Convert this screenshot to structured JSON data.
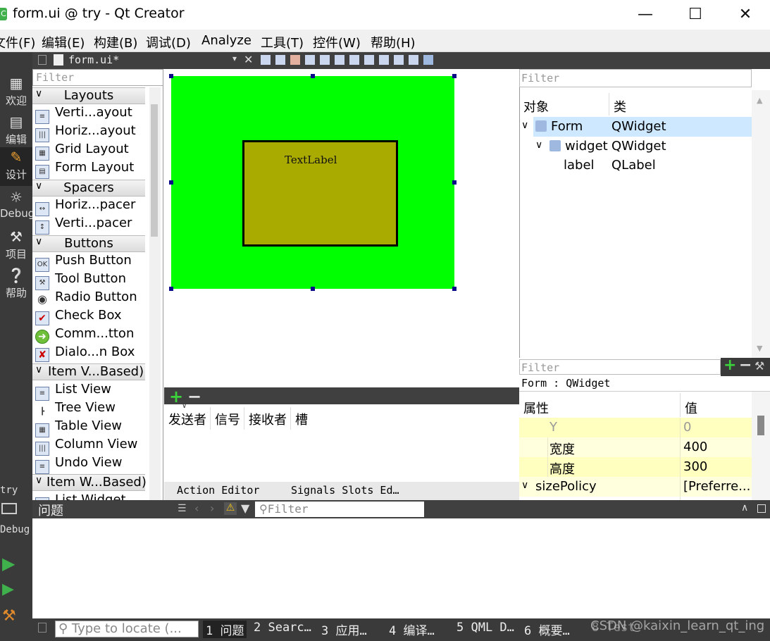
{
  "window": {
    "title": "form.ui @ try - Qt Creator",
    "app_icon": "C"
  },
  "menubar": [
    "文件(F)",
    "编辑(E)",
    "构建(B)",
    "调试(D)",
    "Analyze",
    "工具(T)",
    "控件(W)",
    "帮助(H)"
  ],
  "modes": [
    {
      "label": "欢迎",
      "icon": "grid-icon"
    },
    {
      "label": "编辑",
      "icon": "document-icon"
    },
    {
      "label": "设计",
      "icon": "pencil-icon"
    },
    {
      "label": "Debug",
      "icon": "bug-icon"
    },
    {
      "label": "项目",
      "icon": "wrench-icon"
    },
    {
      "label": "帮助",
      "icon": "help-icon"
    }
  ],
  "kit": {
    "project": "try",
    "config": "Debug"
  },
  "editor_tab": {
    "file": "form.ui*"
  },
  "widgetbox": {
    "filter_placeholder": "Filter",
    "categories": {
      "layouts": "Layouts",
      "spacers": "Spacers",
      "buttons": "Buttons",
      "item_views": "Item V...Based)",
      "item_widgets": "Item W...Based)"
    },
    "layouts": [
      "Verti...ayout",
      "Horiz...ayout",
      "Grid Layout",
      "Form Layout"
    ],
    "spacers": [
      "Horiz...pacer",
      "Verti...pacer"
    ],
    "buttons": [
      "Push Button",
      "Tool Button",
      "Radio Button",
      "Check Box",
      "Comm...tton",
      "Dialo...n Box"
    ],
    "item_views": [
      "List View",
      "Tree View",
      "Table View",
      "Column View",
      "Undo View"
    ],
    "item_widgets": [
      "List Widget"
    ]
  },
  "canvas": {
    "form_color": "#00ff00",
    "widget_color": "#aaab00",
    "label_text": "TextLabel"
  },
  "signals_slots": {
    "columns": [
      "发送者",
      "信号",
      "接收者",
      "槽"
    ],
    "tabs": [
      "Action Editor",
      "Signals  Slots Ed…"
    ]
  },
  "object_inspector": {
    "filter_placeholder": "Filter",
    "headers": [
      "对象",
      "类"
    ],
    "rows": [
      {
        "name": "Form",
        "class": "QWidget"
      },
      {
        "name": "widget",
        "class": "QWidget"
      },
      {
        "name": "label",
        "class": "QLabel"
      }
    ]
  },
  "property_editor": {
    "filter_placeholder": "Filter",
    "object_class": "Form : QWidget",
    "headers": [
      "属性",
      "值"
    ],
    "rows": [
      {
        "name": "Y",
        "value": "0"
      },
      {
        "name": "宽度",
        "value": "400"
      },
      {
        "name": "高度",
        "value": "300"
      },
      {
        "name": "sizePolicy",
        "value": "[Preferre..."
      }
    ]
  },
  "issues": {
    "title": "问题",
    "filter_placeholder": "Filter"
  },
  "statusbar": {
    "locate_placeholder": "Type to locate (...",
    "tabs": [
      "1 问题",
      "2 Searc…",
      "3 应用…",
      "4 编译…",
      "5 QML D…",
      "6 概要…"
    ],
    "watermark": "CSDN @kaixin_learn_qt_ing",
    "hidden_tab": "8 Test"
  }
}
